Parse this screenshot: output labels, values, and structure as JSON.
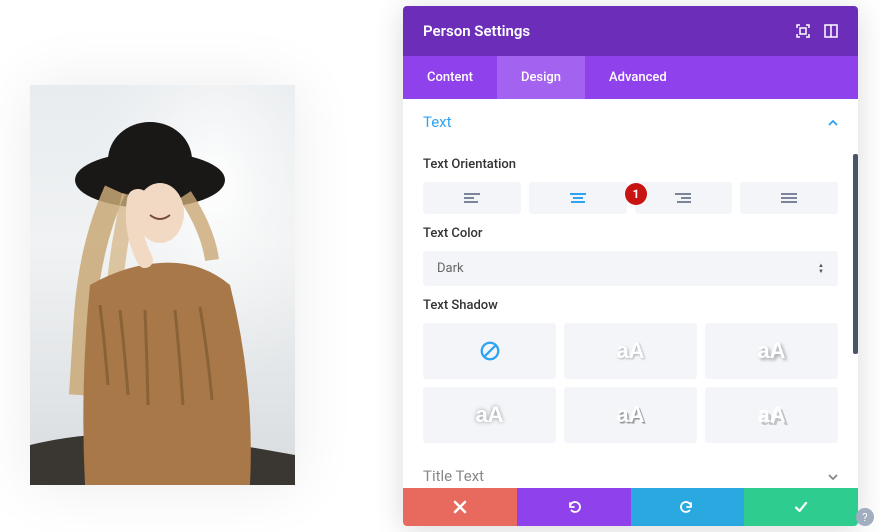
{
  "panel": {
    "title": "Person Settings",
    "tabs": [
      "Content",
      "Design",
      "Advanced"
    ],
    "active_tab_index": 1
  },
  "sections": {
    "text": {
      "title": "Text",
      "fields": {
        "orientation_label": "Text Orientation",
        "color_label": "Text Color",
        "color_value": "Dark",
        "shadow_label": "Text Shadow"
      },
      "shadow_sample": "aA"
    },
    "title_text": {
      "title": "Title Text"
    }
  },
  "annotation": {
    "badge1": "1"
  },
  "help": "?"
}
